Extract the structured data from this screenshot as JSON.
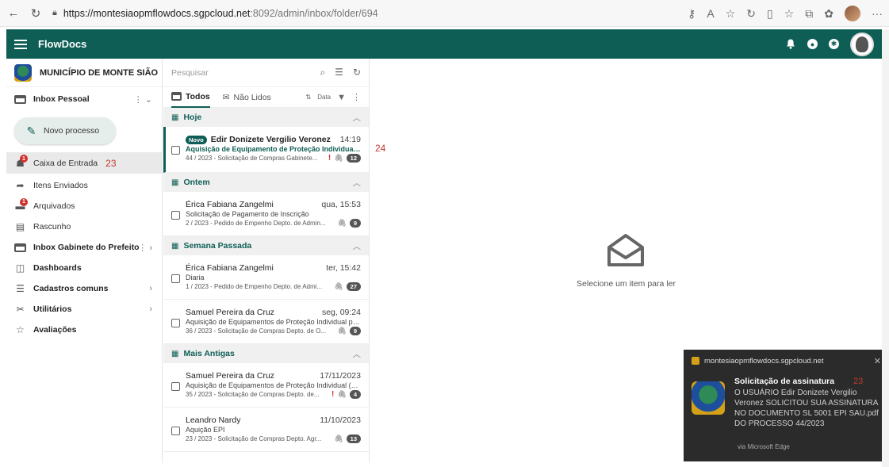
{
  "browser": {
    "url_host": "https://montesiaopmflowdocs.sgpcloud.net",
    "url_rest": ":8092/admin/inbox/folder/694"
  },
  "header": {
    "title": "FlowDocs"
  },
  "sidebar": {
    "org": "MUNICÍPIO DE MONTE SIÃO",
    "inbox_personal": "Inbox Pessoal",
    "new_process": "Novo processo",
    "items": [
      {
        "label": "Caixa de Entrada",
        "annotation": "23"
      },
      {
        "label": "Itens Enviados"
      },
      {
        "label": "Arquivados"
      },
      {
        "label": "Rascunho"
      }
    ],
    "inbox_mayor": "Inbox Gabinete do Prefeito",
    "nav": [
      {
        "label": "Dashboards"
      },
      {
        "label": "Cadastros comuns"
      },
      {
        "label": "Utilitários"
      },
      {
        "label": "Avaliações"
      }
    ]
  },
  "list": {
    "search_placeholder": "Pesquisar",
    "tab_all": "Todos",
    "tab_unread": "Não Lidos",
    "sort_label": "Data",
    "sections": [
      {
        "title": "Hoje",
        "items": [
          {
            "tag": "Novo",
            "sender": "Edir Donizete Vergilio Veronez",
            "time": "14:19",
            "subject": "Aquisição de Equipamento de Proteção Individual pa...",
            "meta": "44 / 2023 - Solicitação de Compras Gabinete...",
            "count": "12"
          }
        ]
      },
      {
        "title": "Ontem",
        "items": [
          {
            "sender": "Érica Fabiana Zangelmi",
            "time": "qua, 15:53",
            "subject": "Solicitação de Pagamento de Inscrição",
            "meta": "2 / 2023 - Pedido de Empenho Depto. de Admin...",
            "count": "9"
          }
        ]
      },
      {
        "title": "Semana Passada",
        "items": [
          {
            "sender": "Érica Fabiana Zangelmi",
            "time": "ter, 15:42",
            "subject": "Diaria",
            "meta": "1 / 2023 - Pedido de Empenho Depto. de Admi...",
            "count": "27"
          },
          {
            "sender": "Samuel Pereira da Cruz",
            "time": "seg, 09:24",
            "subject": "Aquisição de Equipamentos de Proteção Individual pa...",
            "meta": "36 / 2023 - Solicitação de Compras Depto. de O...",
            "count": "9"
          }
        ]
      },
      {
        "title": "Mais Antigas",
        "items": [
          {
            "sender": "Samuel Pereira da Cruz",
            "time": "17/11/2023",
            "subject": "Aquisição de Equipamentos de Proteção Individual (E...",
            "meta": "35 / 2023 - Solicitação de Compras Depto. de...",
            "count": "4"
          },
          {
            "sender": "Leandro Nardy",
            "time": "11/10/2023",
            "subject": "Aquição EPI",
            "meta": "23 / 2023 - Solicitação de Compras Depto. Agr...",
            "count": "13"
          }
        ]
      }
    ]
  },
  "reading": {
    "annotation": "24",
    "empty_text": "Selecione um item para ler"
  },
  "toast": {
    "host": "montesiaopmflowdocs.sgpcloud.net",
    "title": "Solicitação de assinatura",
    "annotation": "23",
    "message": "O USUÁRIO Edir Donizete Vergilio Veronez SOLICITOU SUA ASSINATURA NO DOCUMENTO SL 5001 EPI SAU.pdf DO PROCESSO 44/2023",
    "via": "via Microsoft Edge"
  },
  "colors": {
    "brand": "#0e5e55",
    "alert": "#d0312d",
    "toast_bg": "#2b2b2b"
  }
}
